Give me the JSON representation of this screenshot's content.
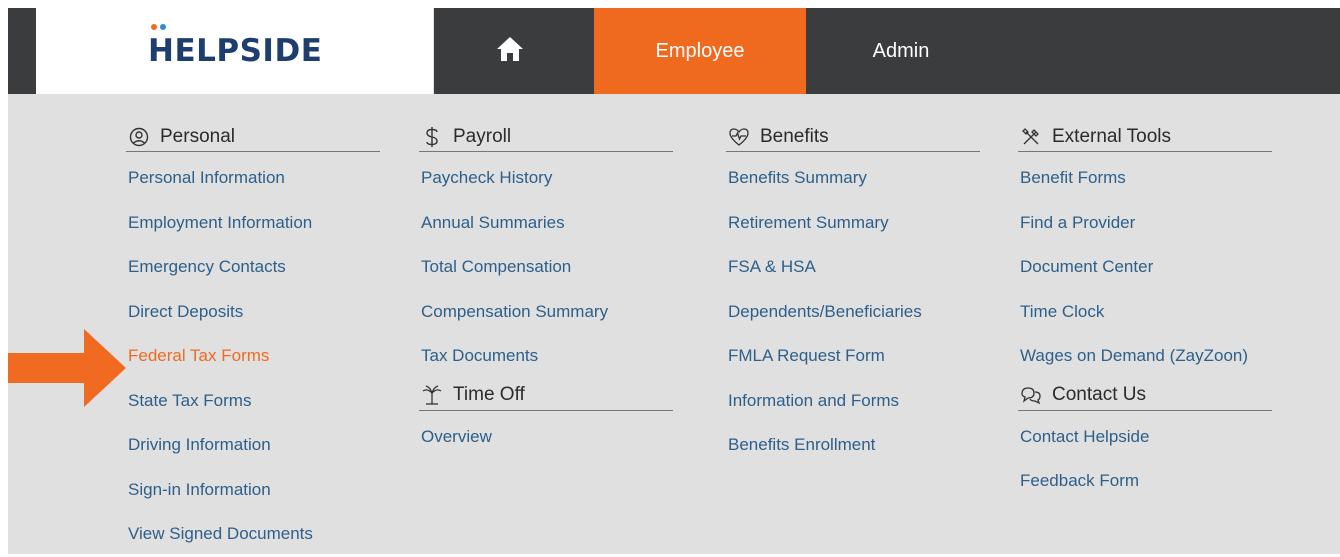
{
  "header": {
    "logo_text": "HELPSIDE",
    "nav": {
      "home_icon": "home-icon",
      "employee_label": "Employee",
      "admin_label": "Admin"
    },
    "active_tab_color": "#ef6a1f"
  },
  "menu": {
    "personal": {
      "title": "Personal",
      "icon": "user-circle-icon",
      "links": [
        "Personal Information",
        "Employment Information",
        "Emergency Contacts",
        "Direct Deposits",
        "Federal Tax Forms",
        "State Tax Forms",
        "Driving Information",
        "Sign-in Information",
        "View Signed Documents"
      ]
    },
    "payroll": {
      "title": "Payroll",
      "icon": "dollar-icon",
      "links": [
        "Paycheck History",
        "Annual Summaries",
        "Total Compensation",
        "Compensation Summary",
        "Tax Documents"
      ]
    },
    "time_off": {
      "title": "Time Off",
      "icon": "palm-tree-icon",
      "links": [
        "Overview"
      ]
    },
    "benefits": {
      "title": "Benefits",
      "icon": "heart-pulse-icon",
      "links": [
        "Benefits Summary",
        "Retirement Summary",
        "FSA & HSA",
        "Dependents/Beneficiaries",
        "FMLA Request Form",
        "Information and Forms",
        "Benefits Enrollment"
      ]
    },
    "external_tools": {
      "title": "External Tools",
      "icon": "tools-icon",
      "links": [
        "Benefit Forms",
        "Find a Provider",
        "Document Center",
        "Time Clock",
        "Wages on Demand (ZayZoon)"
      ]
    },
    "contact_us": {
      "title": "Contact Us",
      "icon": "chat-bubbles-icon",
      "links": [
        "Contact Helpside",
        "Feedback Form"
      ]
    }
  },
  "highlight": {
    "arrow_icon": "arrow-right-icon",
    "highlighted_link": "Federal Tax Forms",
    "color": "#f06b21"
  }
}
